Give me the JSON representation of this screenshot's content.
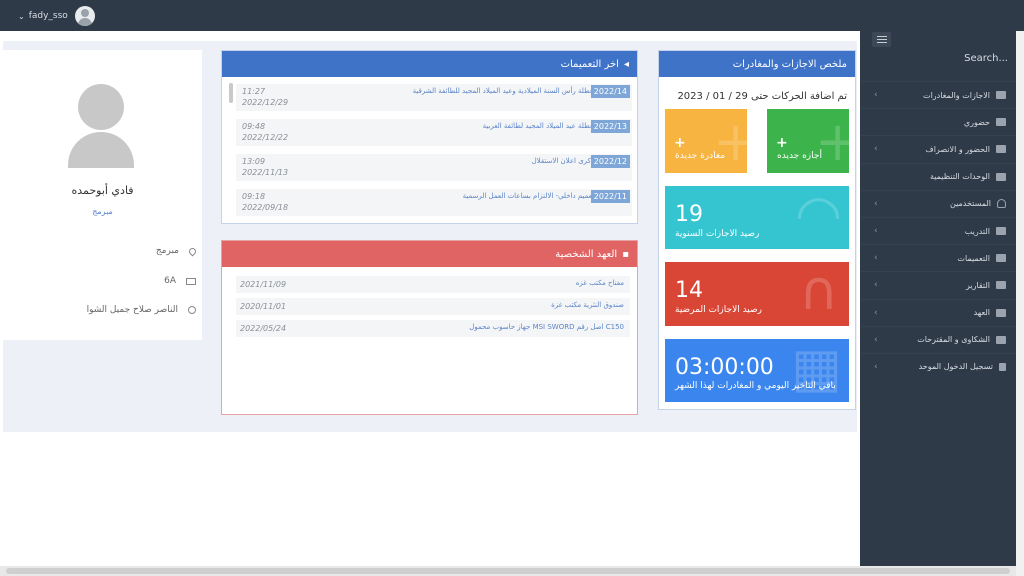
{
  "topbar": {
    "user_name": "fady_sso",
    "caret": "⌄"
  },
  "sidebar": {
    "search_label": "Search...",
    "items": [
      {
        "label": "الاجازات والمغادرات",
        "has_submenu": true,
        "icon": "suitcase-icon"
      },
      {
        "label": "حضوري",
        "has_submenu": false,
        "icon": "calendar-icon"
      },
      {
        "label": "الحضور و الانصراف",
        "has_submenu": true,
        "icon": "sign-in-icon"
      },
      {
        "label": "الوحدات التنظيمية",
        "has_submenu": false,
        "icon": "users-icon"
      },
      {
        "label": "المستخدمين",
        "has_submenu": true,
        "icon": "user-icon"
      },
      {
        "label": "التدريب",
        "has_submenu": true,
        "icon": "graduation-cap-icon"
      },
      {
        "label": "التعميمات",
        "has_submenu": true,
        "icon": "bullhorn-icon"
      },
      {
        "label": "التقارير",
        "has_submenu": true,
        "icon": "file-icon"
      },
      {
        "label": "العهد",
        "has_submenu": true,
        "icon": "briefcase-icon"
      },
      {
        "label": "الشكاوى و المقترحات",
        "has_submenu": true,
        "icon": "edit-icon"
      },
      {
        "label": "تسجيل الدخول الموحد",
        "has_submenu": true,
        "icon": "lock-icon"
      }
    ]
  },
  "summary": {
    "title": "ملخص الاجازات والمغادرات",
    "date_line": "تم اضافة الحركات حتى 29 / 01 / 2023",
    "new_vacation": "أجازه جديده",
    "new_departure": "مغادرة جديدة",
    "plus": "+",
    "annual_value": "19",
    "annual_label": "رصيد الاجازات السنوية",
    "sick_value": "14",
    "sick_label": "رصيد الاجازات المرضية",
    "delay_value": "03:00:00",
    "delay_label": "باقي التاخير اليومي و المغادرات لهذا الشهر",
    "colors": {
      "header": "#3f73c8",
      "vacation": "#3cb44b",
      "departure": "#f7b440",
      "annual": "#35c5d1",
      "sick": "#d94636",
      "delay": "#3b86ee"
    }
  },
  "circulars": {
    "title": "اخر التعميمات",
    "rows": [
      {
        "badge": "2022/14",
        "title": "عطلة رأس السنة الميلادية وعيد الميلاد المجيد للطائفة الشرقية",
        "time": "11:27",
        "date": "2022/12/29"
      },
      {
        "badge": "2022/13",
        "title": "عطلة عيد الميلاد المجيد لطائفة الغربية",
        "time": "09:48",
        "date": "2022/12/22"
      },
      {
        "badge": "2022/12",
        "title": "ذكرى اعلان الاستقلال",
        "time": "13:09",
        "date": "2022/11/13"
      },
      {
        "badge": "2022/11",
        "title": "تعميم داخلي- الالتزام بساعات العمل الرسمية",
        "time": "09:18",
        "date": "2022/09/18"
      }
    ]
  },
  "custody": {
    "title": "العهد الشخصية",
    "rows": [
      {
        "item": "مفتاح مكتب غزه",
        "date": "2021/11/09"
      },
      {
        "item": "صندوق النثرية مكتب غزة",
        "date": "2020/11/01"
      },
      {
        "item": "جهاز حاسوب محمول MSI SWORD اصل رقم C150",
        "date": "2022/05/24"
      }
    ]
  },
  "profile": {
    "name": "فادي أبوحمده",
    "role": "مبرمج",
    "location": "مبرمج",
    "email": "6A",
    "manager": "الناصر صلاح جميل الشوا"
  }
}
